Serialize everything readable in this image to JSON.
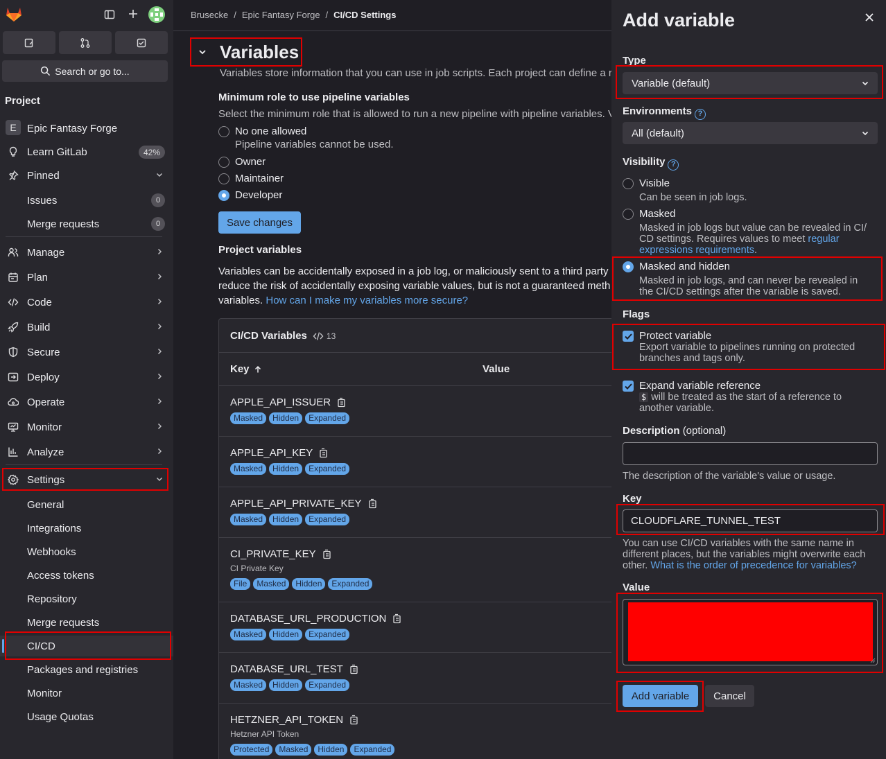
{
  "sidebar": {
    "search_label": "Search or go to...",
    "section_title": "Project",
    "project": {
      "initial": "E",
      "name": "Epic Fantasy Forge"
    },
    "learn": {
      "label": "Learn GitLab",
      "progress": "42%"
    },
    "pinned": {
      "label": "Pinned",
      "items": [
        {
          "label": "Issues",
          "count": "0"
        },
        {
          "label": "Merge requests",
          "count": "0"
        }
      ]
    },
    "nav": [
      "Manage",
      "Plan",
      "Code",
      "Build",
      "Secure",
      "Deploy",
      "Operate",
      "Monitor",
      "Analyze"
    ],
    "settings": {
      "label": "Settings",
      "items": [
        "General",
        "Integrations",
        "Webhooks",
        "Access tokens",
        "Repository",
        "Merge requests",
        "CI/CD",
        "Packages and registries",
        "Monitor",
        "Usage Quotas"
      ]
    }
  },
  "breadcrumb": [
    "Brusecke",
    "Epic Fantasy Forge",
    "CI/CD Settings"
  ],
  "variables_section": {
    "title": "Variables",
    "description": "Variables store information that you can use in job scripts. Each project can define a r",
    "min_role": {
      "heading": "Minimum role to use pipeline variables",
      "description": "Select the minimum role that is allowed to run a new pipeline with pipeline variables. V",
      "options": [
        {
          "label": "No one allowed",
          "help": "Pipeline variables cannot be used.",
          "selected": false
        },
        {
          "label": "Owner",
          "selected": false
        },
        {
          "label": "Maintainer",
          "selected": false
        },
        {
          "label": "Developer",
          "selected": true
        }
      ],
      "save_label": "Save changes"
    },
    "project_vars": {
      "heading": "Project variables",
      "line1": "Variables can be accidentally exposed in a job log, or maliciously sent to a third party",
      "line2": "reduce the risk of accidentally exposing variable values, but is not a guaranteed meth",
      "line3": "variables.",
      "link": "How can I make my variables more secure?"
    },
    "table": {
      "title": "CI/CD Variables",
      "count": "13",
      "col_key": "Key",
      "col_value": "Value",
      "rows": [
        {
          "key": "APPLE_API_ISSUER",
          "desc": "",
          "tags": [
            "Masked",
            "Hidden",
            "Expanded"
          ]
        },
        {
          "key": "APPLE_API_KEY",
          "desc": "",
          "tags": [
            "Masked",
            "Hidden",
            "Expanded"
          ]
        },
        {
          "key": "APPLE_API_PRIVATE_KEY",
          "desc": "",
          "tags": [
            "Masked",
            "Hidden",
            "Expanded"
          ]
        },
        {
          "key": "CI_PRIVATE_KEY",
          "desc": "CI Private Key",
          "tags": [
            "File",
            "Masked",
            "Hidden",
            "Expanded"
          ]
        },
        {
          "key": "DATABASE_URL_PRODUCTION",
          "desc": "",
          "tags": [
            "Masked",
            "Hidden",
            "Expanded"
          ]
        },
        {
          "key": "DATABASE_URL_TEST",
          "desc": "",
          "tags": [
            "Masked",
            "Hidden",
            "Expanded"
          ]
        },
        {
          "key": "HETZNER_API_TOKEN",
          "desc": "Hetzner API Token",
          "tags": [
            "Protected",
            "Masked",
            "Hidden",
            "Expanded"
          ]
        }
      ]
    }
  },
  "drawer": {
    "title": "Add variable",
    "type_label": "Type",
    "type_value": "Variable (default)",
    "env_label": "Environments",
    "env_value": "All (default)",
    "visibility_label": "Visibility",
    "visibility": [
      {
        "label": "Visible",
        "help": "Can be seen in job logs.",
        "selected": false
      },
      {
        "label": "Masked",
        "help1": "Masked in job logs but value can be revealed in CI/",
        "help2": "CD settings. Requires values to meet ",
        "help_link1": "regular",
        "help_link2": "expressions requirements",
        "help_end": ".",
        "selected": false
      },
      {
        "label": "Masked and hidden",
        "help1": "Masked in job logs, and can never be revealed in",
        "help2": "the CI/CD settings after the variable is saved.",
        "selected": true
      }
    ],
    "flags_label": "Flags",
    "protect": {
      "label": "Protect variable",
      "help1": "Export variable to pipelines running on protected",
      "help2": "branches and tags only.",
      "checked": true
    },
    "expand": {
      "label": "Expand variable reference",
      "code": "$",
      "help1": " will be treated as the start of a reference to",
      "help2": "another variable.",
      "checked": true
    },
    "description_label": "Description",
    "description_optional": "(optional)",
    "description_value": "",
    "description_help": "The description of the variable's value or usage.",
    "key_label": "Key",
    "key_value": "CLOUDFLARE_TUNNEL_TEST",
    "key_help1": "You can use CI/CD variables with the same name in",
    "key_help2": "different places, but the variables might overwrite each",
    "key_help3": "other.",
    "key_help_link": "What is the order of precedence for variables?",
    "value_label": "Value",
    "redaction_color": "#ff0000",
    "add_label": "Add variable",
    "cancel_label": "Cancel"
  },
  "colors": {
    "accent": "#63a6e9",
    "annotation": "#e00000"
  }
}
